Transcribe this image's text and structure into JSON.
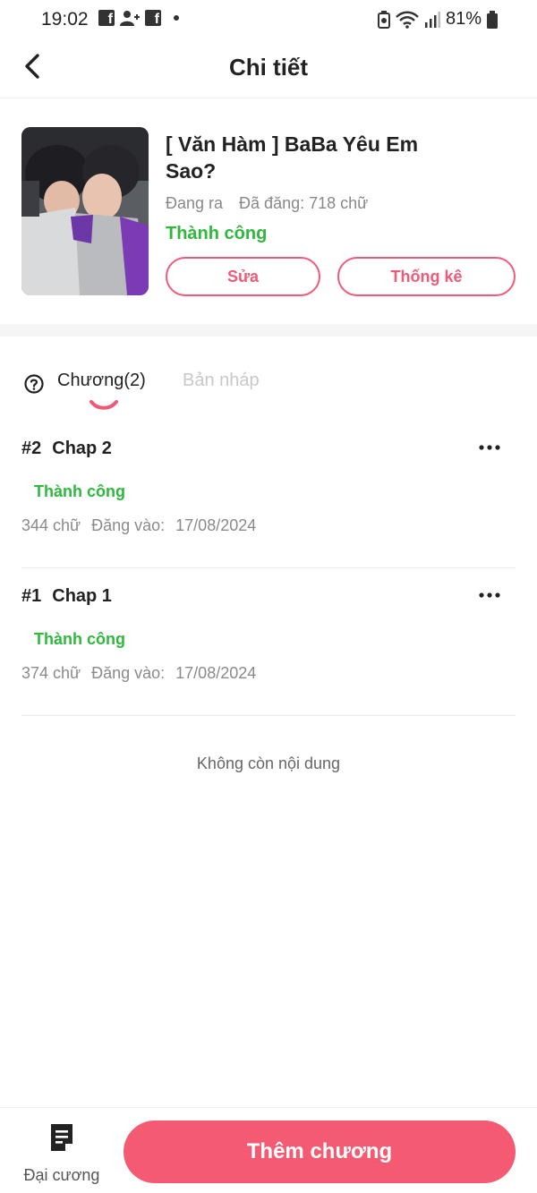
{
  "status_bar": {
    "time": "19:02",
    "battery": "81%",
    "icons": [
      "facebook-icon",
      "add-friend-icon",
      "facebook-icon",
      "notification-dot",
      "battery-saver-icon",
      "wifi-icon",
      "signal-icon",
      "battery-icon"
    ]
  },
  "header": {
    "title": "Chi tiết",
    "back_icon": "chevron-left-icon"
  },
  "book": {
    "title": "[ Văn Hàm ] BaBa Yêu Em Sao?",
    "state": "Đang ra",
    "word_count": "Đã đăng: 718 chữ",
    "status": "Thành công",
    "edit_label": "Sửa",
    "stats_label": "Thống kê"
  },
  "tabs": {
    "help_icon": "question-circle-icon",
    "chapters_label": "Chương(2)",
    "drafts_label": "Bản nháp"
  },
  "chapters": [
    {
      "number": "#2",
      "title": "Chap 2",
      "status": "Thành công",
      "words": "344 chữ",
      "posted_label": "Đăng vào:",
      "date": "17/08/2024"
    },
    {
      "number": "#1",
      "title": "Chap 1",
      "status": "Thành công",
      "words": "374 chữ",
      "posted_label": "Đăng vào:",
      "date": "17/08/2024"
    }
  ],
  "list_end_text": "Không còn nội dung",
  "bottom": {
    "outline_label": "Đại cương",
    "outline_icon": "document-list-icon",
    "add_chapter_label": "Thêm chương"
  },
  "colors": {
    "accent": "#f45a72",
    "outline_accent": "#f05a78",
    "success": "#2db93b"
  }
}
